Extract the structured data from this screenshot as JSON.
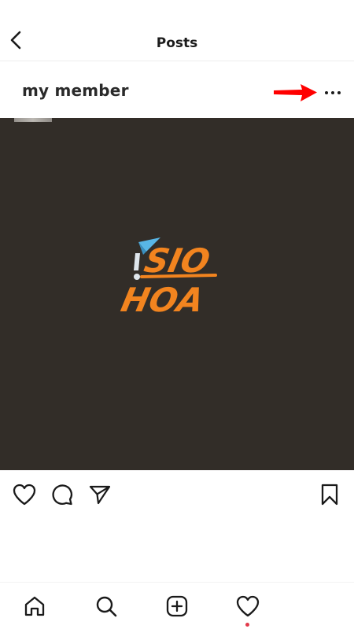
{
  "header": {
    "title": "Posts",
    "back_icon": "chevron-left-icon"
  },
  "post": {
    "username": "my member",
    "more_icon": "more-horizontal-icon",
    "annotation_icon": "red-arrow-icon",
    "image": {
      "background_color": "#322d28",
      "logo_text_top": "SIO",
      "logo_text_bottom": "HOA",
      "logo_color": "#f2841f",
      "logo_accent_color": "#58b6e6"
    },
    "actions": {
      "like_icon": "heart-icon",
      "comment_icon": "comment-icon",
      "share_icon": "send-icon",
      "save_icon": "bookmark-icon"
    }
  },
  "bottom_nav": {
    "items": [
      {
        "icon": "home-icon"
      },
      {
        "icon": "search-icon"
      },
      {
        "icon": "add-post-icon"
      },
      {
        "icon": "activity-heart-icon"
      }
    ],
    "notification_color": "#e23a4b"
  },
  "colors": {
    "annotation_red": "#ff0000",
    "icon_color": "#1a1a1a"
  }
}
